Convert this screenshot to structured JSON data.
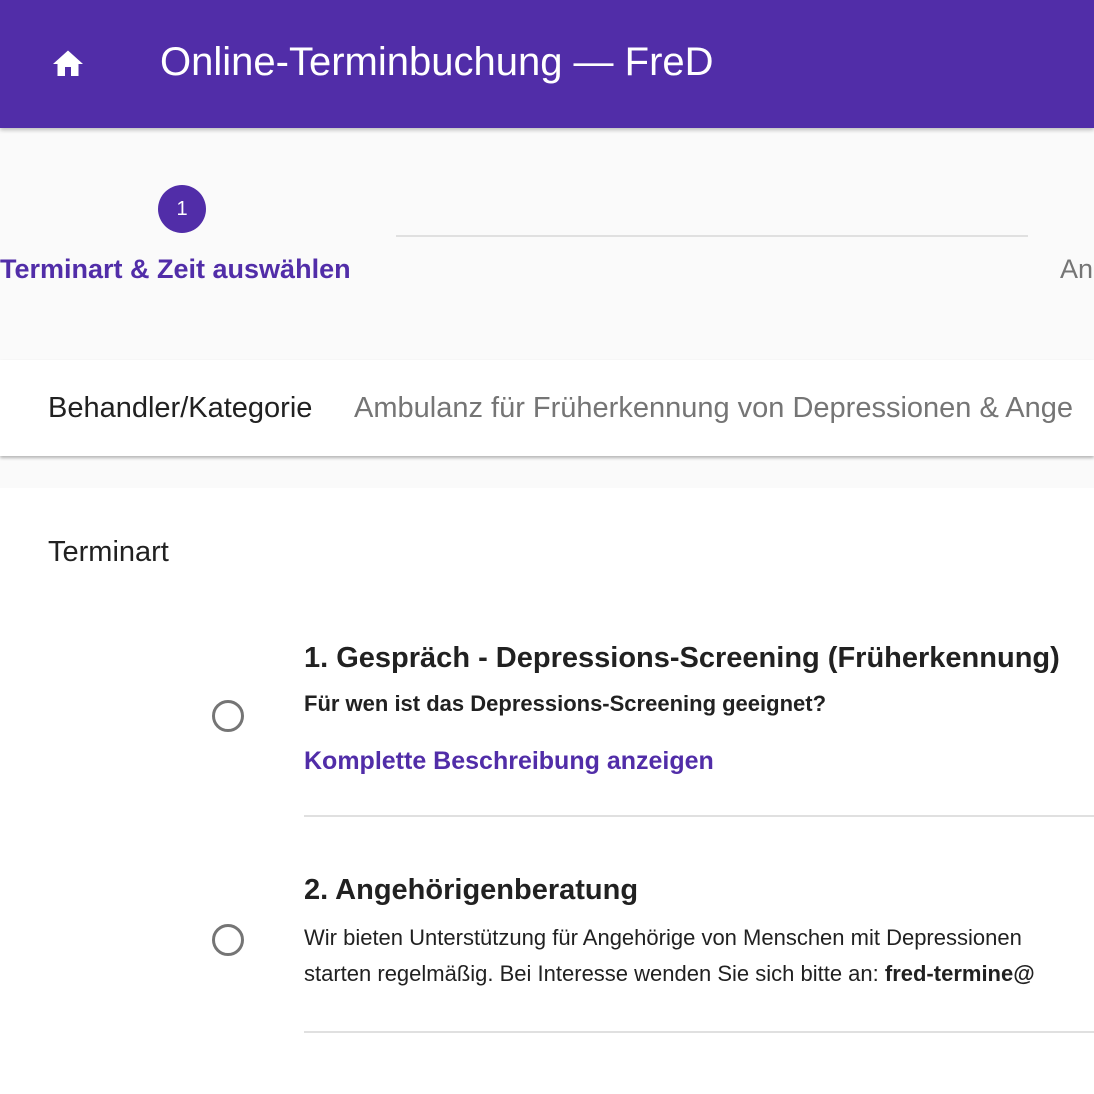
{
  "app_bar": {
    "home_icon": "home-icon",
    "title": "Online-Terminbuchung — FreD",
    "color": "#512da8"
  },
  "stepper": {
    "steps": [
      {
        "number": "1",
        "label": "Terminart & Zeit auswählen",
        "active": true
      },
      {
        "label": "An",
        "active": false
      }
    ]
  },
  "category": {
    "label": "Behandler/Kategorie",
    "value": "Ambulanz für Früherkennung von Depressionen & Ange"
  },
  "terminart": {
    "title": "Terminart",
    "options": [
      {
        "title": "1. Gespräch - Depressions-Screening (Früherkennung)",
        "subtitle": "Für wen ist das Depressions-Screening geeignet?",
        "link": "Komplette Beschreibung anzeigen",
        "selected": false
      },
      {
        "title": "2. Angehörigenberatung",
        "desc_line1": "Wir bieten Unterstützung für Angehörige von Menschen mit Depressionen",
        "desc_line2_text": "starten regelmäßig. Bei Interesse wenden Sie sich bitte an: ",
        "desc_line2_bold": "fred-termine@",
        "selected": false
      }
    ]
  }
}
